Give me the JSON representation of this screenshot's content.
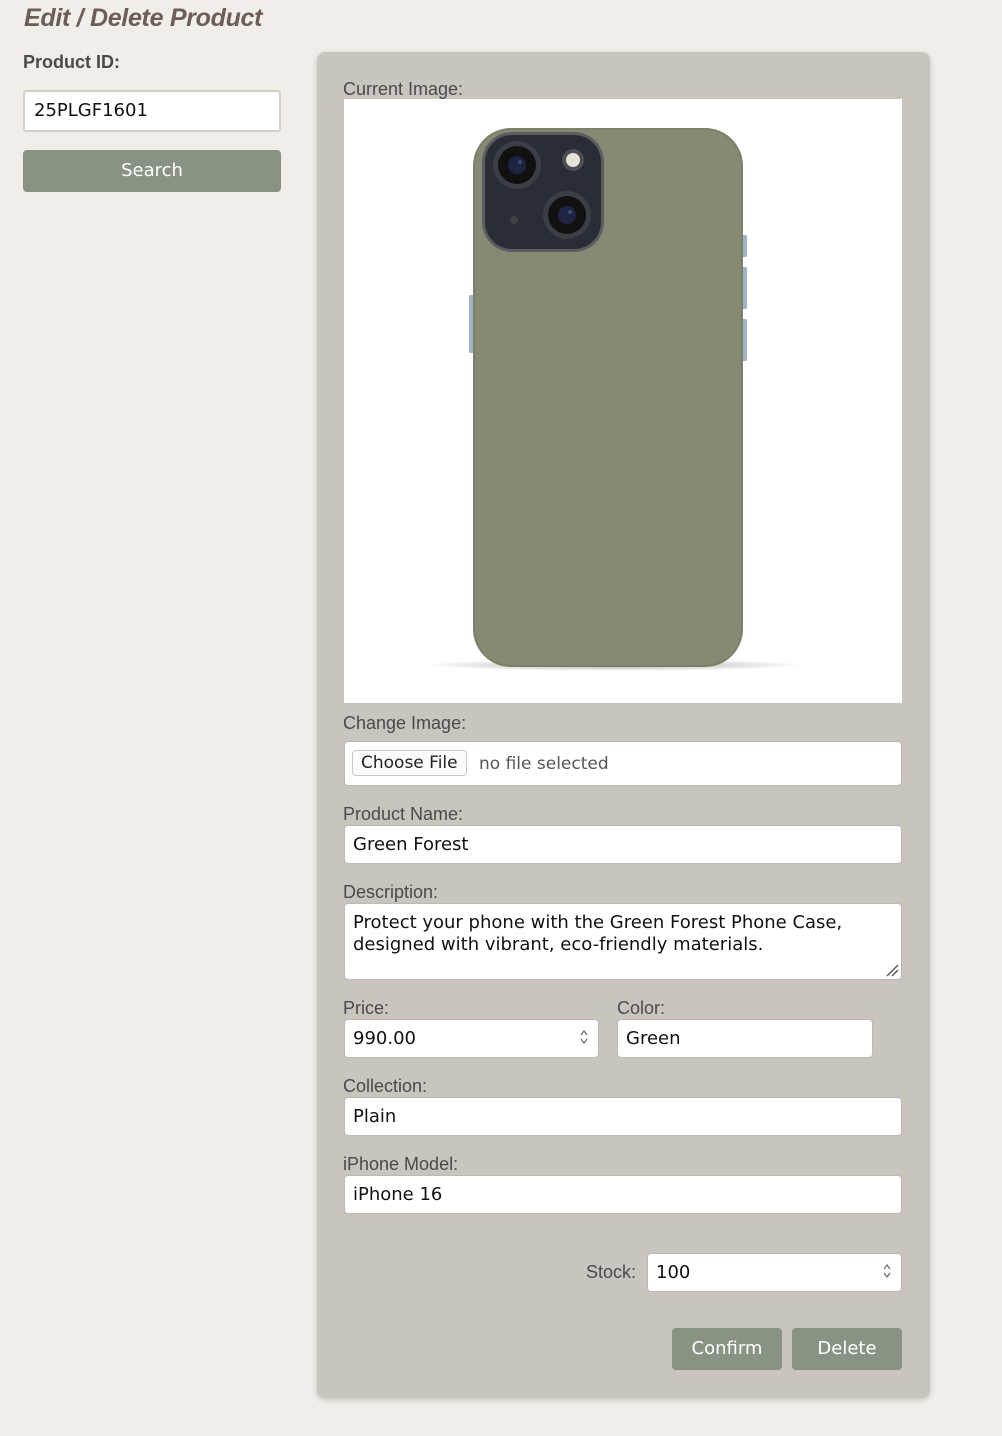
{
  "page": {
    "title": "Edit / Delete Product"
  },
  "search": {
    "label": "Product ID:",
    "value": "25PLGF1601",
    "button_label": "Search"
  },
  "form": {
    "current_image_label": "Current Image:",
    "product_image": {
      "depicts": "green phone case",
      "case_color": "#878a72"
    },
    "change_image_label": "Change Image:",
    "choose_file_label": "Choose File",
    "file_status": "no file selected",
    "name_label": "Product Name:",
    "name_value": "Green Forest",
    "description_label": "Description:",
    "description_line1": "Protect your phone with the Green Forest Phone Case,",
    "description_line2": "designed with vibrant, eco-friendly materials.",
    "price_label": "Price:",
    "price_value": "990.00",
    "color_label": "Color:",
    "color_value": "Green",
    "collection_label": "Collection:",
    "collection_value": "Plain",
    "model_label": "iPhone Model:",
    "model_value": "iPhone 16",
    "stock_label": "Stock:",
    "stock_value": "100",
    "confirm_label": "Confirm",
    "delete_label": "Delete"
  },
  "colors": {
    "background": "#f1ede9",
    "panel": "#c9c4bd",
    "button": "#889384",
    "title": "#6b5d58"
  }
}
